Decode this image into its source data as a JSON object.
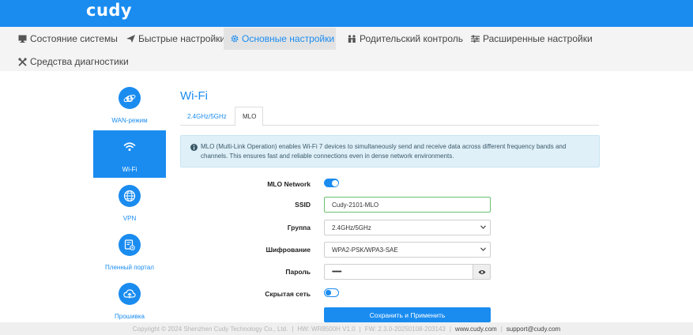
{
  "brand": {
    "logo": "cudy"
  },
  "nav": [
    {
      "label": "Состояние системы",
      "icon": "monitor-icon"
    },
    {
      "label": "Быстрые настройки",
      "icon": "paper-plane-icon"
    },
    {
      "label": "Основные настройки",
      "icon": "gear-icon",
      "active": true
    },
    {
      "label": "Родительский контроль",
      "icon": "family-icon"
    },
    {
      "label": "Расширенные настройки",
      "icon": "sliders-icon"
    },
    {
      "label": "Средства диагностики",
      "icon": "tools-icon"
    }
  ],
  "sidebar": [
    {
      "label": "WAN-режим",
      "icon": "internet-explorer-icon"
    },
    {
      "label": "Wi-Fi",
      "icon": "wifi-icon",
      "active": true
    },
    {
      "label": "VPN",
      "icon": "globe-icon"
    },
    {
      "label": "Пленный портал",
      "icon": "portal-icon"
    },
    {
      "label": "Прошивка",
      "icon": "cloud-upload-icon"
    }
  ],
  "main": {
    "title": "Wi-Fi",
    "tabs": [
      {
        "label": "2.4GHz/5GHz"
      },
      {
        "label": "MLO",
        "active": true
      }
    ],
    "info": "MLO (Multi-Link Operation) enables Wi-Fi 7 devices to simultaneously send and receive data across different frequency bands and channels. This ensures fast and reliable connections even in dense network environments.",
    "form": {
      "mlo_network": {
        "label": "MLO Network",
        "enabled": true
      },
      "ssid": {
        "label": "SSID",
        "value": "Cudy-2101-MLO"
      },
      "band": {
        "label": "Группа",
        "value": "2.4GHz/5GHz"
      },
      "encryption": {
        "label": "Шифрование",
        "value": "WPA2-PSK/WPA3-SAE"
      },
      "password": {
        "label": "Пароль",
        "value": "••••••••"
      },
      "hidden": {
        "label": "Скрытая сеть",
        "enabled": false
      }
    },
    "save_label": "Сохранить и Применить"
  },
  "footer": {
    "copyright": "Copyright © 2024 Shenzhen Cudy Technology Co., Ltd.",
    "hw": "HW: WR8500H V1.0",
    "fw": "FW: 2.3.0-20250108-203143",
    "site": "www.cudy.com",
    "email": "support@cudy.com"
  },
  "colors": {
    "accent": "#1a8cf0",
    "header": "#1a8cf0",
    "focus_border": "#6cc070"
  }
}
